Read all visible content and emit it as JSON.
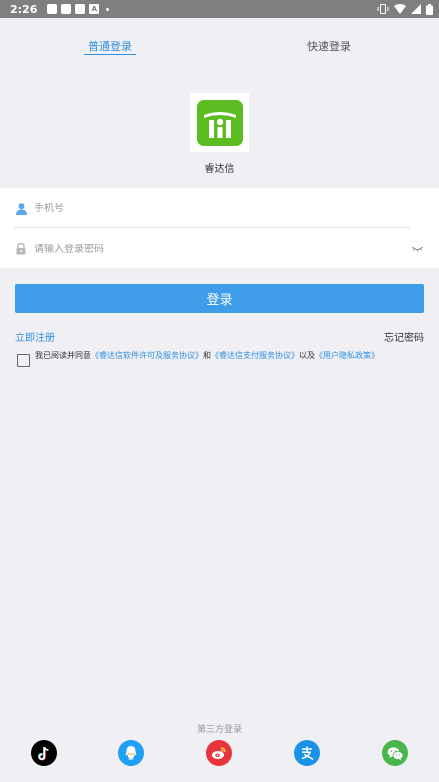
{
  "status_bar": {
    "time": "2:26",
    "notification_badge": "A"
  },
  "tabs": {
    "normal_login": "普通登录",
    "quick_login": "快速登录"
  },
  "app": {
    "name": "睿达信"
  },
  "form": {
    "phone_placeholder": "手机号",
    "password_placeholder": "请输入登录密码"
  },
  "login_button": "登录",
  "links": {
    "register": "立即注册",
    "forgot": "忘记密码"
  },
  "agreement": {
    "prefix": "我已阅读并同意",
    "doc1": "《睿达信软件许可及服务协议》",
    "and": "和",
    "doc2": "《睿达信支付服务协议》",
    "and2": "以及",
    "doc3": "《用户隐私政策》"
  },
  "third_party": {
    "title": "第三方登录"
  },
  "colors": {
    "accent": "#3e9ce8",
    "link": "#2f8fe0",
    "logo_green": "#5cbd23"
  }
}
